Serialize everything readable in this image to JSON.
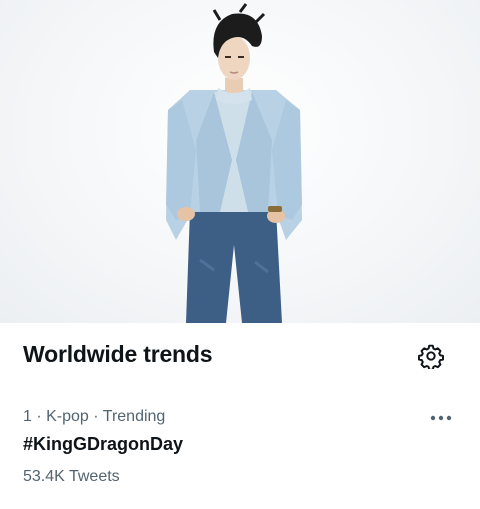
{
  "header": {
    "title": "Worldwide trends",
    "settings_icon": "gear-icon"
  },
  "trend": {
    "rank": "1",
    "category": "K-pop",
    "status": "Trending",
    "separator": " · ",
    "hashtag": "#KingGDragonDay",
    "tweet_count": "53.4K Tweets",
    "more_icon": "more-dots-icon"
  },
  "colors": {
    "text_primary": "#0f1419",
    "text_secondary": "#536471",
    "jacket": "#b9d1e4",
    "jeans": "#3d5f86"
  }
}
